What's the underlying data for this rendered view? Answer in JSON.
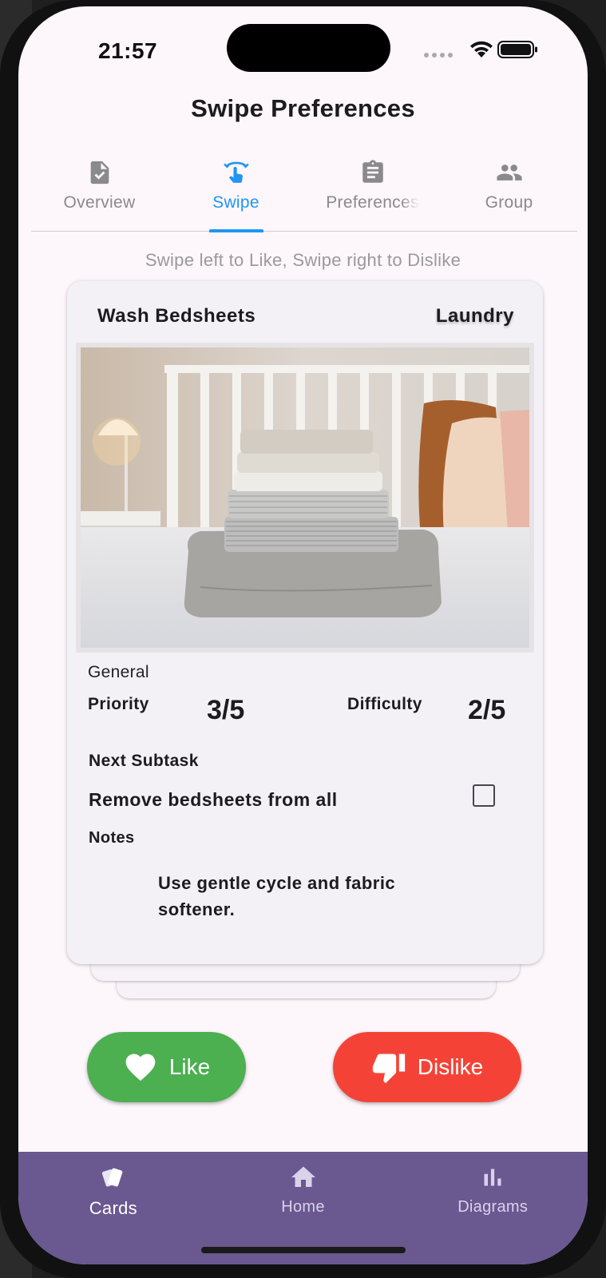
{
  "status_bar": {
    "time": "21:57"
  },
  "app_bar": {
    "title": "Swipe Preferences"
  },
  "tabs": [
    {
      "label": "Overview",
      "icon": "task-check-icon",
      "active": false
    },
    {
      "label": "Swipe",
      "icon": "swipe-gesture-icon",
      "active": true
    },
    {
      "label": "Preferences",
      "icon": "clipboard-icon",
      "active": false
    },
    {
      "label": "Group",
      "icon": "people-icon",
      "active": false
    }
  ],
  "hint": "Swipe left to Like, Swipe right to Dislike",
  "card": {
    "title": "Wash Bedsheets",
    "category": "Laundry",
    "image_subject": "stack of folded bedsheets on a bed",
    "section": "General",
    "priority_label": "Priority",
    "priority_value": "3/5",
    "difficulty_label": "Difficulty",
    "difficulty_value": "2/5",
    "next_subtask_label": "Next Subtask",
    "next_subtask": "Remove bedsheets from all",
    "subtask_done": false,
    "notes_label": "Notes",
    "notes": "Use gentle cycle and fabric softener."
  },
  "actions": {
    "like_label": "Like",
    "dislike_label": "Dislike"
  },
  "bottom_nav": [
    {
      "label": "Cards",
      "icon": "cards-icon",
      "active": true
    },
    {
      "label": "Home",
      "icon": "home-icon",
      "active": false
    },
    {
      "label": "Diagrams",
      "icon": "bar-chart-icon",
      "active": false
    }
  ],
  "colors": {
    "accent": "#2196f3",
    "like": "#4caf50",
    "dislike": "#f44336",
    "nav_background": "#6a5891",
    "background": "#fdf6fb"
  }
}
